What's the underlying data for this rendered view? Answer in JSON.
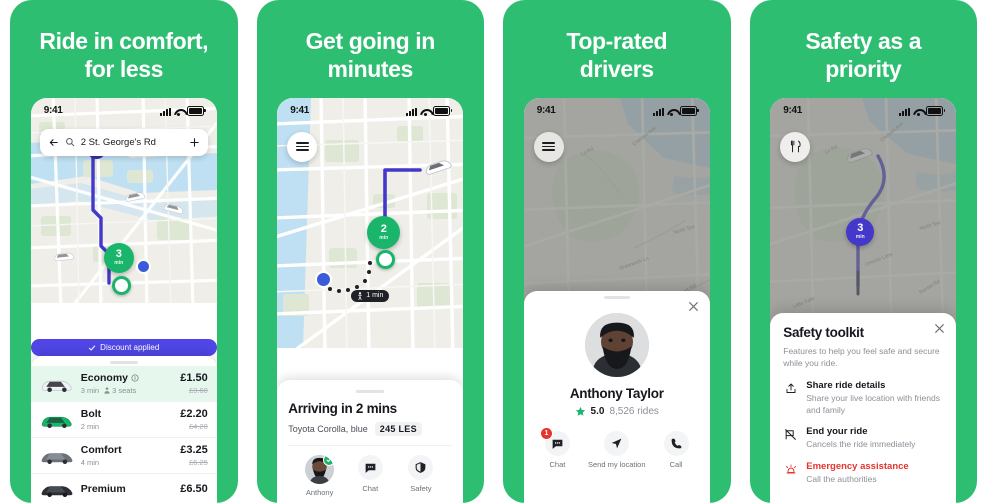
{
  "theme": {
    "brand_green": "#2dbe71",
    "accent_blue": "#4f46e5",
    "danger_red": "#e5342d",
    "map_green_pin": "#18b56a"
  },
  "panels": [
    {
      "headline": "Ride in comfort,\nfor less",
      "status": {
        "clock": "9:41"
      },
      "search": {
        "value": "2 St. George's Rd",
        "back_icon": "arrow-left-icon",
        "search_icon": "search-icon",
        "add_icon": "plus-icon"
      },
      "map": {
        "pin_number": "3",
        "pin_unit": "min"
      },
      "discount": {
        "label": "Discount applied",
        "check": "check-icon"
      },
      "rides": [
        {
          "name": "Economy",
          "info_icon": "info-icon",
          "eta": "3 min",
          "seats": "3 seats",
          "price": "£1.50",
          "old_price": "£3.60",
          "selected": true,
          "car_color": "#e9ebec"
        },
        {
          "name": "Bolt",
          "info_icon": "",
          "eta": "2 min",
          "seats": "",
          "price": "£2.20",
          "old_price": "£4.20",
          "selected": false,
          "car_color": "#18b56a"
        },
        {
          "name": "Comfort",
          "info_icon": "",
          "eta": "4 min",
          "seats": "",
          "price": "£3.25",
          "old_price": "£6.25",
          "selected": false,
          "car_color": "#6b7079"
        },
        {
          "name": "Premium",
          "info_icon": "",
          "eta": "",
          "seats": "",
          "price": "£6.50",
          "old_price": "",
          "selected": false,
          "car_color": "#2b2e33"
        }
      ]
    },
    {
      "headline": "Get going in\nminutes",
      "status": {
        "clock": "9:41"
      },
      "menu_icon": "hamburger-menu-icon",
      "map": {
        "pin_number": "2",
        "pin_unit": "min",
        "walk_chip": "1 min",
        "walk_icon": "pedestrian-icon"
      },
      "card": {
        "title": "Arriving in 2 mins",
        "car": "Toyota Corolla, blue",
        "plate": "245 LES"
      },
      "nav": [
        {
          "label": "Anthony",
          "icon": "driver-avatar",
          "badge": ""
        },
        {
          "label": "Chat",
          "icon": "chat-icon",
          "badge": ""
        },
        {
          "label": "Safety",
          "icon": "shield-icon",
          "badge": ""
        }
      ]
    },
    {
      "headline": "Top-rated\ndrivers",
      "status": {
        "clock": "9:41"
      },
      "menu_icon": "hamburger-menu-icon",
      "modal": {
        "close_icon": "close-icon",
        "driver_name": "Anthony Taylor",
        "rating": "5.0",
        "rides": "8,526 rides",
        "star_icon": "star-icon",
        "actions": [
          {
            "label": "Chat",
            "icon": "chat-icon",
            "badge": "1"
          },
          {
            "label": "Send my location",
            "icon": "location-arrow-icon",
            "badge": ""
          },
          {
            "label": "Call",
            "icon": "phone-icon",
            "badge": ""
          }
        ]
      }
    },
    {
      "headline": "Safety as a\npriority",
      "status": {
        "clock": "9:41"
      },
      "menu_icon": "restaurant-icon",
      "map": {
        "pin_number": "3",
        "pin_unit": "min"
      },
      "modal": {
        "close_icon": "close-icon",
        "title": "Safety toolkit",
        "description": "Features to help you feel safe and secure while you ride.",
        "items": [
          {
            "title": "Share ride details",
            "desc": "Share your live location with friends and family",
            "icon": "share-upload-icon",
            "danger": false
          },
          {
            "title": "End your ride",
            "desc": "Cancels the ride immediately",
            "icon": "end-ride-icon",
            "danger": false
          },
          {
            "title": "Emergency assistance",
            "desc": "Call the authorities",
            "icon": "siren-icon",
            "danger": true
          }
        ]
      }
    }
  ]
}
